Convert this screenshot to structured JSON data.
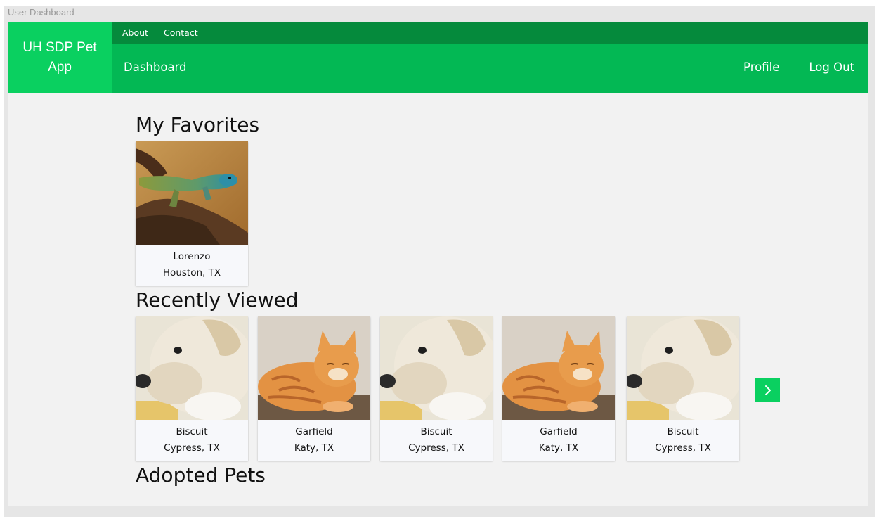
{
  "window": {
    "title": "User Dashboard"
  },
  "brand": {
    "line1": "UH SDP Pet",
    "line2": "App"
  },
  "topbar": {
    "links": [
      "About",
      "Contact"
    ]
  },
  "nav": {
    "dashboard": "Dashboard",
    "profile": "Profile",
    "logout": "Log Out"
  },
  "sections": {
    "favorites": "My Favorites",
    "recent": "Recently Viewed",
    "adopted": "Adopted Pets"
  },
  "favorites": [
    {
      "name": "Lorenzo",
      "location": "Houston, TX",
      "image": "lizard"
    }
  ],
  "recent": [
    {
      "name": "Biscuit",
      "location": "Cypress, TX",
      "image": "puppy"
    },
    {
      "name": "Garfield",
      "location": "Katy, TX",
      "image": "cat"
    },
    {
      "name": "Biscuit",
      "location": "Cypress, TX",
      "image": "puppy"
    },
    {
      "name": "Garfield",
      "location": "Katy, TX",
      "image": "cat"
    },
    {
      "name": "Biscuit",
      "location": "Cypress, TX",
      "image": "puppy"
    }
  ],
  "controls": {
    "next_icon": "chevron-right-icon"
  },
  "colors": {
    "brand": "#0ad060",
    "topbar": "#058a3c",
    "navbar": "#03b854",
    "background": "#f2f2f2"
  }
}
